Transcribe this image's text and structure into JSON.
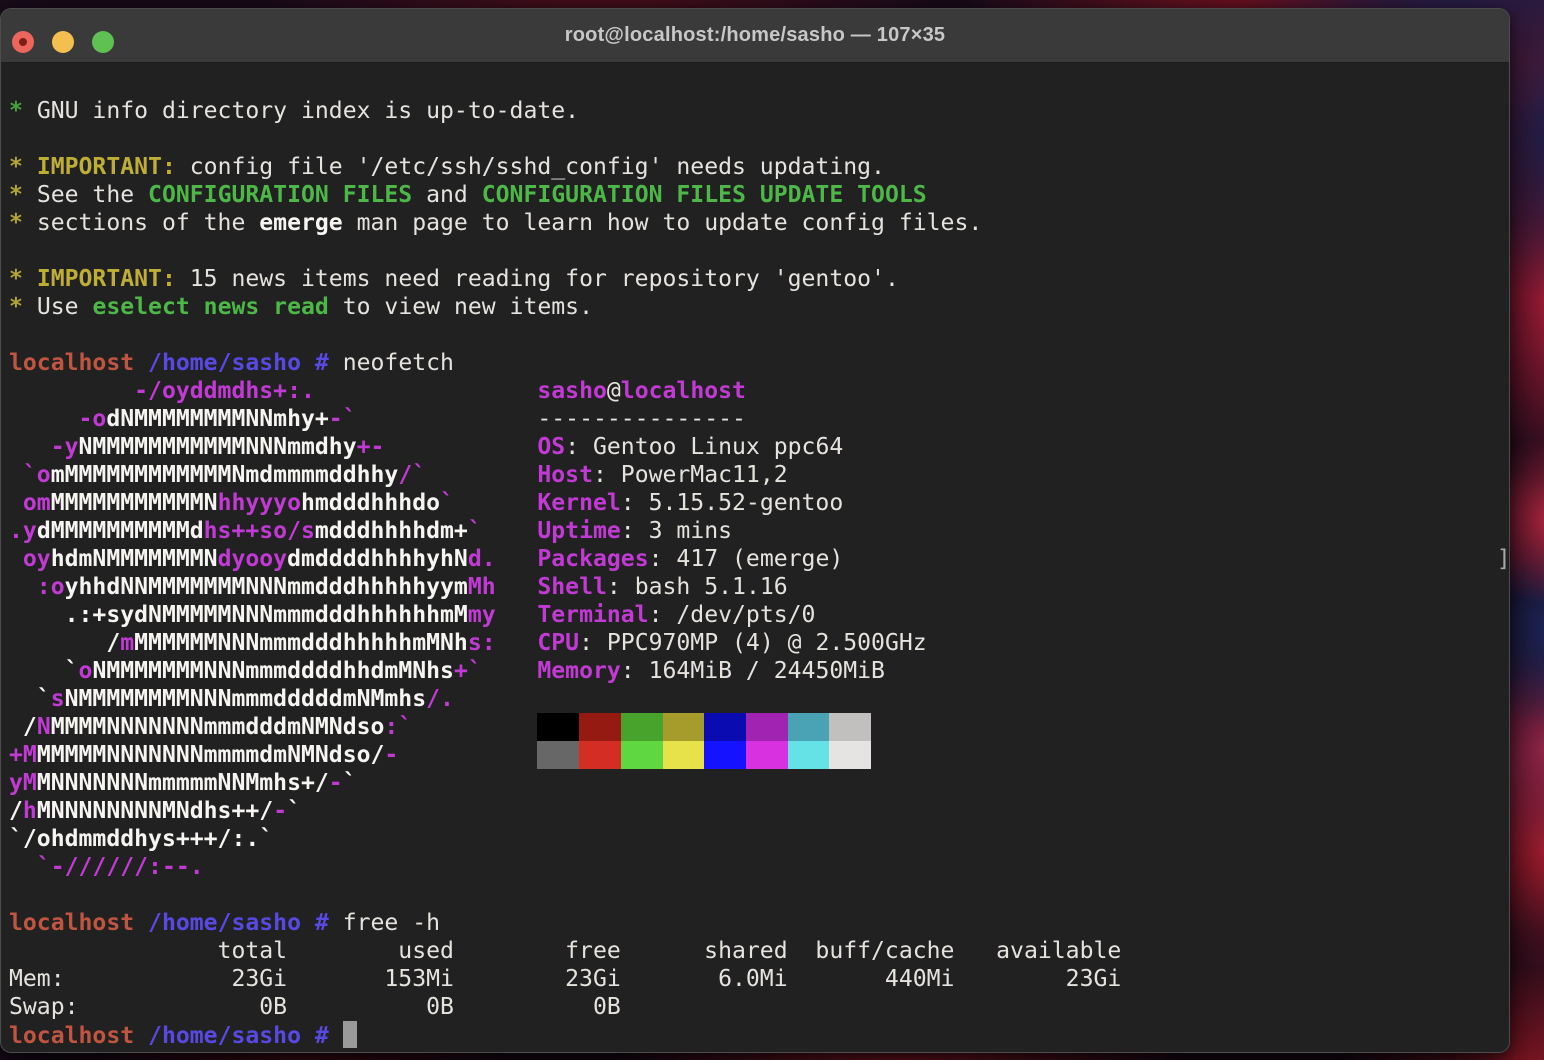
{
  "window": {
    "title": "root@localhost:/home/sasho — 107×35",
    "titlebar_buttons": [
      "close",
      "minimize",
      "zoom"
    ],
    "grid_size": "107×35"
  },
  "colors": {
    "terminal_bg": "#212122",
    "titlebar_bg": "#3a3a3b",
    "title_text": "#c8c7c7",
    "traffic_red": "#ec665c",
    "traffic_red_dot": "#7e1f15",
    "traffic_yellow": "#f3bf4e",
    "traffic_green": "#5ec152"
  },
  "styles": {
    "w": {
      "color": "#e6e3de",
      "bold": false
    },
    "W": {
      "color": "#f7f5f1",
      "bold": true
    },
    "g": {
      "color": "#43a33a",
      "bold": true
    },
    "G": {
      "color": "#4db847",
      "bold": true
    },
    "y": {
      "color": "#b4a335",
      "bold": true
    },
    "Y": {
      "color": "#bfae35",
      "bold": true
    },
    "r": {
      "color": "#c15540",
      "bold": true
    },
    "b": {
      "color": "#5849e2",
      "bold": true
    },
    "m": {
      "color": "#c23ad4",
      "bold": true
    },
    "d": {
      "color": "#a8a8a8",
      "bold": false
    }
  },
  "palette": {
    "c0": "#000000",
    "c1": "#951a11",
    "c2": "#48a32d",
    "c3": "#a59c2c",
    "c4": "#0b0bb2",
    "c5": "#a123b1",
    "c6": "#4aa3b4",
    "c7": "#c1c0bf",
    "C0": "#676767",
    "C1": "#d42d23",
    "C2": "#5ed741",
    "C3": "#e7e24a",
    "C4": "#1512ff",
    "C5": "#d832e0",
    "C6": "#65e2e6",
    "C7": "#e5e4e3"
  },
  "cursor": {
    "color": "#9a9a9a"
  },
  "terminal": {
    "lines": [
      [],
      [
        [
          "g",
          "* "
        ],
        [
          "w",
          "GNU info directory index is up-to-date."
        ]
      ],
      [],
      [
        [
          "y",
          "* "
        ],
        [
          "Y",
          "IMPORTANT:"
        ],
        [
          "w",
          " config file '/etc/ssh/sshd_config' needs updating."
        ]
      ],
      [
        [
          "y",
          "* "
        ],
        [
          "w",
          "See the "
        ],
        [
          "G",
          "CONFIGURATION FILES"
        ],
        [
          "w",
          " and "
        ],
        [
          "G",
          "CONFIGURATION FILES UPDATE TOOLS"
        ]
      ],
      [
        [
          "y",
          "* "
        ],
        [
          "w",
          "sections of the "
        ],
        [
          "W",
          "emerge"
        ],
        [
          "w",
          " man page to learn how to update config files."
        ]
      ],
      [],
      [
        [
          "y",
          "* "
        ],
        [
          "Y",
          "IMPORTANT:"
        ],
        [
          "w",
          " 15 news items need reading for repository 'gentoo'."
        ]
      ],
      [
        [
          "y",
          "* "
        ],
        [
          "w",
          "Use "
        ],
        [
          "G",
          "eselect news read"
        ],
        [
          "w",
          " to view new items."
        ]
      ],
      [],
      [
        [
          "r",
          "localhost"
        ],
        [
          "w",
          " "
        ],
        [
          "b",
          "/home/sasho"
        ],
        [
          "w",
          " "
        ],
        [
          "b",
          "#"
        ],
        [
          "w",
          " neofetch"
        ]
      ],
      [
        [
          "m",
          "         -/oyddmdhs+:."
        ],
        [
          "w",
          "                "
        ],
        [
          "m",
          "sasho"
        ],
        [
          "w",
          "@"
        ],
        [
          "m",
          "localhost"
        ]
      ],
      [
        [
          "m",
          "     -o"
        ],
        [
          "W",
          "dNMMMMMMMMNNmhy+"
        ],
        [
          "m",
          "-`"
        ],
        [
          "w",
          "             "
        ],
        [
          "w",
          "---------------"
        ]
      ],
      [
        [
          "m",
          "   -y"
        ],
        [
          "W",
          "NMMMMMMMMMMMNNNmmdhy"
        ],
        [
          "m",
          "+-"
        ],
        [
          "w",
          "           "
        ],
        [
          "m",
          "OS"
        ],
        [
          "w",
          ": Gentoo Linux ppc64"
        ]
      ],
      [
        [
          "m",
          " `o"
        ],
        [
          "W",
          "mMMMMMMMMMMMMNmdmmmmddhhy"
        ],
        [
          "m",
          "/`"
        ],
        [
          "w",
          "        "
        ],
        [
          "m",
          "Host"
        ],
        [
          "w",
          ": PowerMac11,2"
        ]
      ],
      [
        [
          "m",
          " om"
        ],
        [
          "W",
          "MMMMMMMMMMMN"
        ],
        [
          "m",
          "hhyyyo"
        ],
        [
          "W",
          "hmdddhhhdo"
        ],
        [
          "m",
          "`"
        ],
        [
          "w",
          "      "
        ],
        [
          "m",
          "Kernel"
        ],
        [
          "w",
          ": 5.15.52-gentoo"
        ]
      ],
      [
        [
          "m",
          ".y"
        ],
        [
          "W",
          "dMMMMMMMMMMd"
        ],
        [
          "m",
          "hs++so/s"
        ],
        [
          "W",
          "mdddhhhhdm+"
        ],
        [
          "m",
          "`"
        ],
        [
          "w",
          "    "
        ],
        [
          "m",
          "Uptime"
        ],
        [
          "w",
          ": 3 mins"
        ]
      ],
      [
        [
          "m",
          " oy"
        ],
        [
          "W",
          "hdmNMMMMMMMN"
        ],
        [
          "m",
          "dyooy"
        ],
        [
          "W",
          "dmddddhhhhyhN"
        ],
        [
          "m",
          "d."
        ],
        [
          "w",
          "   "
        ],
        [
          "m",
          "Packages"
        ],
        [
          "w",
          ": 417 (emerge)"
        ],
        [
          "w",
          "                                               "
        ],
        [
          "d",
          "]"
        ]
      ],
      [
        [
          "m",
          "  :o"
        ],
        [
          "W",
          "yhhdNNMMMMMMMNNNmmdddhhhhhyym"
        ],
        [
          "m",
          "Mh"
        ],
        [
          "w",
          "   "
        ],
        [
          "m",
          "Shell"
        ],
        [
          "w",
          ": bash 5.1.16"
        ]
      ],
      [
        [
          "W",
          "    .:+sydNMMMMMNNNmmmdddhhhhhhmM"
        ],
        [
          "m",
          "my"
        ],
        [
          "w",
          "   "
        ],
        [
          "m",
          "Terminal"
        ],
        [
          "w",
          ": /dev/pts/0"
        ]
      ],
      [
        [
          "W",
          "       /"
        ],
        [
          "m",
          "m"
        ],
        [
          "W",
          "MMMMMMNNNmmmdddhhhhhmMNh"
        ],
        [
          "m",
          "s:"
        ],
        [
          "w",
          "   "
        ],
        [
          "m",
          "CPU"
        ],
        [
          "w",
          ": PPC970MP (4) @ 2.500GHz"
        ]
      ],
      [
        [
          "W",
          "    `"
        ],
        [
          "m",
          "o"
        ],
        [
          "W",
          "NMMMMMMMNNNmmmddddhhdmMNhs"
        ],
        [
          "m",
          "+`"
        ],
        [
          "w",
          "    "
        ],
        [
          "m",
          "Memory"
        ],
        [
          "w",
          ": 164MiB / 24450MiB"
        ]
      ],
      [
        [
          "W",
          "  `"
        ],
        [
          "m",
          "s"
        ],
        [
          "W",
          "NMMMMMMMMNNNmmmdddddmNMmhs"
        ],
        [
          "m",
          "/."
        ]
      ],
      [
        [
          "W",
          " /"
        ],
        [
          "m",
          "N"
        ],
        [
          "W",
          "MMMMNNNNNNNmmmdddmNMNdso"
        ],
        [
          "m",
          ":`"
        ],
        [
          "w",
          "         "
        ],
        [
          "bg:c0",
          "   "
        ],
        [
          "bg:c1",
          "   "
        ],
        [
          "bg:c2",
          "   "
        ],
        [
          "bg:c3",
          "   "
        ],
        [
          "bg:c4",
          "   "
        ],
        [
          "bg:c5",
          "   "
        ],
        [
          "bg:c6",
          "   "
        ],
        [
          "bg:c7",
          "   "
        ]
      ],
      [
        [
          "m",
          "+M"
        ],
        [
          "W",
          "MMMMMNNNNNNNmmmmdmNMNdso/"
        ],
        [
          "m",
          "-"
        ],
        [
          "w",
          "          "
        ],
        [
          "bg:C0",
          "   "
        ],
        [
          "bg:C1",
          "   "
        ],
        [
          "bg:C2",
          "   "
        ],
        [
          "bg:C3",
          "   "
        ],
        [
          "bg:C4",
          "   "
        ],
        [
          "bg:C5",
          "   "
        ],
        [
          "bg:C6",
          "   "
        ],
        [
          "bg:C7",
          "   "
        ]
      ],
      [
        [
          "m",
          "yM"
        ],
        [
          "W",
          "MNNNNNNNmmmmmNNMmhs+/"
        ],
        [
          "m",
          "-"
        ],
        [
          "W",
          "`"
        ]
      ],
      [
        [
          "W",
          "/"
        ],
        [
          "m",
          "h"
        ],
        [
          "W",
          "MNNNNNNNNMNdhs++/"
        ],
        [
          "m",
          "-"
        ],
        [
          "W",
          "`"
        ]
      ],
      [
        [
          "W",
          "`/ohdmmddhys+++/:.`"
        ]
      ],
      [
        [
          "m",
          "  `-//////:--."
        ]
      ],
      [],
      [
        [
          "r",
          "localhost"
        ],
        [
          "w",
          " "
        ],
        [
          "b",
          "/home/sasho"
        ],
        [
          "w",
          " "
        ],
        [
          "b",
          "#"
        ],
        [
          "w",
          " free -h"
        ]
      ],
      [
        [
          "w",
          "               total        used        free      shared  buff/cache   available"
        ]
      ],
      [
        [
          "w",
          "Mem:            23Gi       153Mi        23Gi       6.0Mi       440Mi        23Gi"
        ]
      ],
      [
        [
          "w",
          "Swap:             0B          0B          0B"
        ]
      ],
      [
        [
          "r",
          "localhost"
        ],
        [
          "w",
          " "
        ],
        [
          "b",
          "/home/sasho"
        ],
        [
          "w",
          " "
        ],
        [
          "b",
          "#"
        ],
        [
          "w",
          " "
        ],
        [
          "cursor",
          " "
        ]
      ]
    ]
  }
}
